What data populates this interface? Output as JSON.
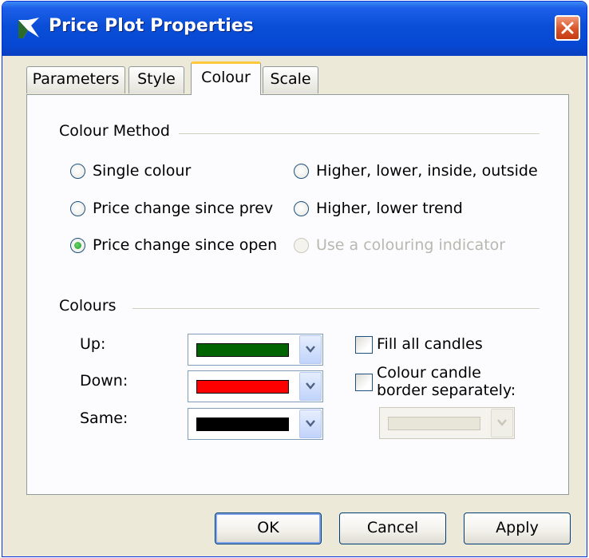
{
  "window": {
    "title": "Price Plot Properties"
  },
  "icons": {
    "app": "chart-logo-icon",
    "close": "close-icon",
    "dropdown": "chevron-down-icon"
  },
  "tabs": [
    {
      "label": "Parameters"
    },
    {
      "label": "Style"
    },
    {
      "label": "Colour",
      "active": true
    },
    {
      "label": "Scale"
    }
  ],
  "colour_method": {
    "heading": "Colour Method",
    "options": [
      {
        "label": "Single colour",
        "selected": false,
        "enabled": true
      },
      {
        "label": "Price change since prev",
        "selected": false,
        "enabled": true
      },
      {
        "label": "Price change since open",
        "selected": true,
        "enabled": true
      },
      {
        "label": "Higher, lower, inside, outside",
        "selected": false,
        "enabled": true
      },
      {
        "label": "Higher, lower trend",
        "selected": false,
        "enabled": true
      },
      {
        "label": "Use a colouring indicator",
        "selected": false,
        "enabled": false
      }
    ]
  },
  "colours": {
    "heading": "Colours",
    "up": {
      "label": "Up:",
      "color": "#006400"
    },
    "down": {
      "label": "Down:",
      "color": "#ff0000"
    },
    "same": {
      "label": "Same:",
      "color": "#000000"
    },
    "fill_all": {
      "label": "Fill all candles",
      "checked": false
    },
    "border_separately": {
      "label_line1": "Colour candle",
      "label_line2": "border separately:",
      "checked": false
    },
    "border_colour": {
      "enabled": false
    }
  },
  "buttons": {
    "ok": "OK",
    "cancel": "Cancel",
    "apply": "Apply"
  },
  "palette": {
    "title_bar": "#0a4ed8",
    "dialog_bg": "#ece9d8",
    "tab_highlight": "#ffc83c",
    "close_button": "#d9532a"
  }
}
